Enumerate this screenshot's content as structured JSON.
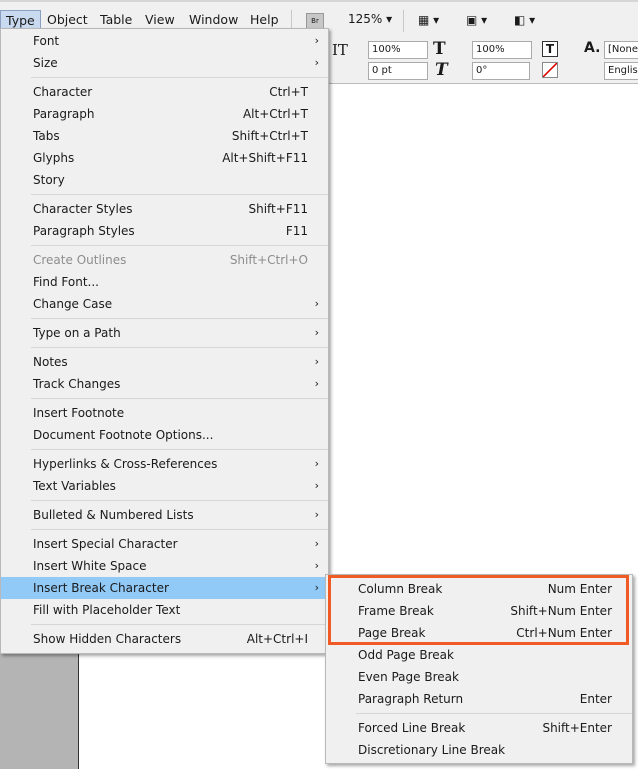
{
  "menubar": {
    "items": [
      "Type",
      "Object",
      "Table",
      "View",
      "Window",
      "Help"
    ],
    "bridge": "Br",
    "zoom": "125%"
  },
  "control": {
    "h_scale": "100%",
    "v_scale": "100%",
    "baseline": "0 pt",
    "skew": "0°",
    "style": "[None]",
    "language": "English"
  },
  "type_menu": [
    [
      {
        "label": "Font",
        "arrow": true
      },
      {
        "label": "Size",
        "arrow": true
      }
    ],
    [
      {
        "label": "Character",
        "shortcut": "Ctrl+T"
      },
      {
        "label": "Paragraph",
        "shortcut": "Alt+Ctrl+T"
      },
      {
        "label": "Tabs",
        "shortcut": "Shift+Ctrl+T"
      },
      {
        "label": "Glyphs",
        "shortcut": "Alt+Shift+F11"
      },
      {
        "label": "Story"
      }
    ],
    [
      {
        "label": "Character Styles",
        "shortcut": "Shift+F11"
      },
      {
        "label": "Paragraph Styles",
        "shortcut": "F11"
      }
    ],
    [
      {
        "label": "Create Outlines",
        "shortcut": "Shift+Ctrl+O",
        "disabled": true
      },
      {
        "label": "Find Font..."
      },
      {
        "label": "Change Case",
        "arrow": true
      }
    ],
    [
      {
        "label": "Type on a Path",
        "arrow": true
      }
    ],
    [
      {
        "label": "Notes",
        "arrow": true
      },
      {
        "label": "Track Changes",
        "arrow": true
      }
    ],
    [
      {
        "label": "Insert Footnote"
      },
      {
        "label": "Document Footnote Options..."
      }
    ],
    [
      {
        "label": "Hyperlinks & Cross-References",
        "arrow": true
      },
      {
        "label": "Text Variables",
        "arrow": true
      }
    ],
    [
      {
        "label": "Bulleted & Numbered Lists",
        "arrow": true
      }
    ],
    [
      {
        "label": "Insert Special Character",
        "arrow": true
      },
      {
        "label": "Insert White Space",
        "arrow": true
      },
      {
        "label": "Insert Break Character",
        "arrow": true,
        "highlighted": true
      },
      {
        "label": "Fill with Placeholder Text"
      }
    ],
    [
      {
        "label": "Show Hidden Characters",
        "shortcut": "Alt+Ctrl+I"
      }
    ]
  ],
  "break_submenu": [
    [
      {
        "label": "Column Break",
        "shortcut": "Num Enter"
      },
      {
        "label": "Frame Break",
        "shortcut": "Shift+Num Enter"
      },
      {
        "label": "Page Break",
        "shortcut": "Ctrl+Num Enter"
      },
      {
        "label": "Odd Page Break"
      },
      {
        "label": "Even Page Break"
      },
      {
        "label": "Paragraph Return",
        "shortcut": "Enter"
      }
    ],
    [
      {
        "label": "Forced Line Break",
        "shortcut": "Shift+Enter"
      },
      {
        "label": "Discretionary Line Break"
      }
    ]
  ],
  "colors": {
    "highlight": "#91c9f7",
    "annotation": "#f05a24"
  }
}
